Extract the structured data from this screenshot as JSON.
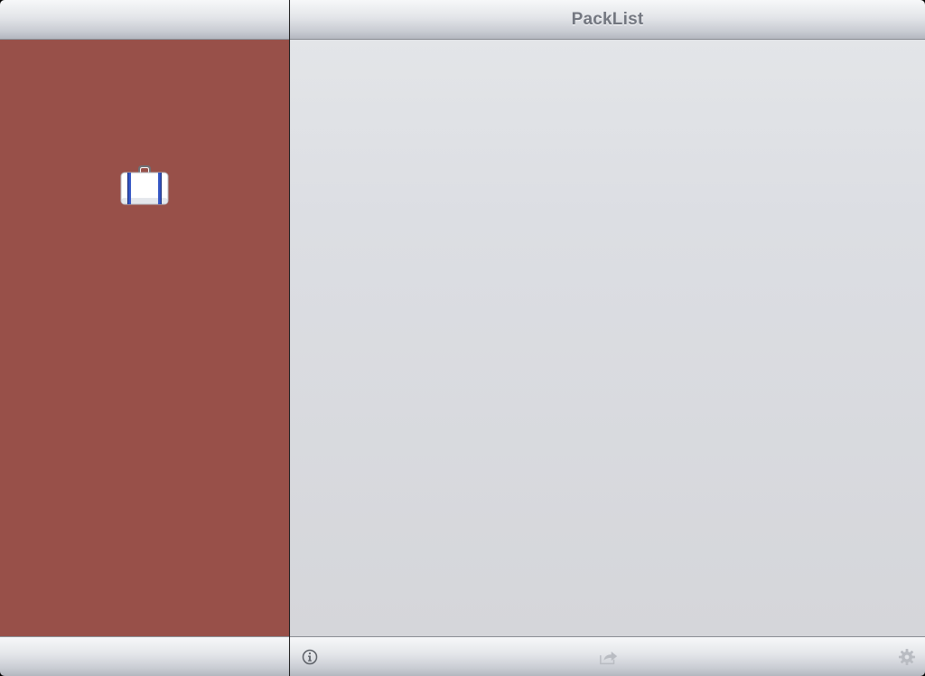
{
  "window": {
    "title": "PackList"
  },
  "colors": {
    "master_background": "#985049",
    "detail_background": "#dcdee3",
    "title_color": "#737780"
  },
  "master": {
    "logo_icon": "suitcase-icon"
  },
  "toolbar": {
    "items": [
      {
        "icon": "info-icon",
        "enabled": true
      },
      {
        "icon": "share-icon",
        "enabled": false
      },
      {
        "icon": "gear-icon",
        "enabled": false
      }
    ]
  }
}
